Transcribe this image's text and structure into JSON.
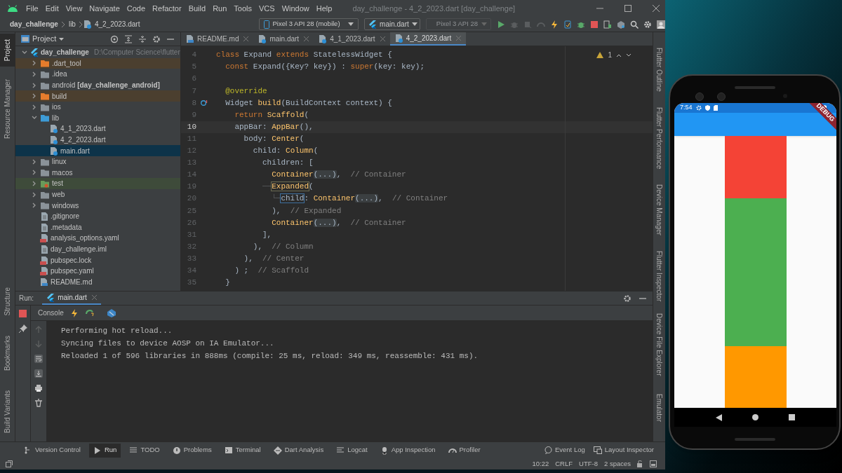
{
  "window": {
    "title": "day_challenge - 4_2_2023.dart [day_challenge]"
  },
  "menu": [
    "File",
    "Edit",
    "View",
    "Navigate",
    "Code",
    "Refactor",
    "Build",
    "Run",
    "Tools",
    "VCS",
    "Window",
    "Help"
  ],
  "breadcrumb": [
    "day_challenge",
    "lib",
    "4_2_2023.dart"
  ],
  "toolbar": {
    "device": "Pixel 3 API 28 (mobile)",
    "config": "main.dart",
    "disabled_device": "Pixel 3 API 28"
  },
  "left_strip_top": [
    {
      "label": "Project",
      "selected": true
    },
    {
      "label": "Resource Manager",
      "selected": false
    }
  ],
  "left_strip_bottom": [
    {
      "label": "Structure",
      "selected": false
    },
    {
      "label": "Bookmarks",
      "selected": false
    },
    {
      "label": "Build Variants",
      "selected": false
    }
  ],
  "right_strip_top": [
    "Flutter Outline",
    "Flutter Performance",
    "Device Manager",
    "Flutter Inspector"
  ],
  "right_strip_bottom": [
    "Device File Explorer",
    "Emulator"
  ],
  "project_panel": {
    "title": "Project",
    "tree": [
      {
        "name": "day_challenge",
        "path": "D:\\Computer Science\\flutter",
        "kind": "root",
        "expanded": true,
        "selected": false,
        "children": [
          {
            "name": ".dart_tool",
            "kind": "excluded_folder",
            "expanded": false,
            "selected": false
          },
          {
            "name": ".idea",
            "kind": "folder",
            "expanded": false,
            "selected": false
          },
          {
            "name": "android **[day_challenge_android]**",
            "kind": "folder",
            "expanded": false,
            "selected": false
          },
          {
            "name": "build",
            "kind": "excluded_folder",
            "expanded": false,
            "selected": false
          },
          {
            "name": "ios",
            "kind": "folder",
            "expanded": false,
            "selected": false
          },
          {
            "name": "lib",
            "kind": "source_folder",
            "expanded": true,
            "selected": false,
            "children": [
              {
                "name": "4_1_2023.dart",
                "kind": "dart",
                "selected": false
              },
              {
                "name": "4_2_2023.dart",
                "kind": "dart",
                "selected": false
              },
              {
                "name": "main.dart",
                "kind": "dart",
                "selected": true
              }
            ]
          },
          {
            "name": "linux",
            "kind": "folder",
            "expanded": false,
            "selected": false
          },
          {
            "name": "macos",
            "kind": "folder",
            "expanded": false,
            "selected": false
          },
          {
            "name": "test",
            "kind": "test_folder",
            "expanded": false,
            "selected": false
          },
          {
            "name": "web",
            "kind": "folder",
            "expanded": false,
            "selected": false
          },
          {
            "name": "windows",
            "kind": "folder",
            "expanded": false,
            "selected": false
          },
          {
            "name": ".gitignore",
            "kind": "file",
            "selected": false
          },
          {
            "name": ".metadata",
            "kind": "file",
            "selected": false
          },
          {
            "name": "analysis_options.yaml",
            "kind": "yaml",
            "selected": false
          },
          {
            "name": "day_challenge.iml",
            "kind": "file",
            "selected": false
          },
          {
            "name": "pubspec.lock",
            "kind": "yaml",
            "selected": false
          },
          {
            "name": "pubspec.yaml",
            "kind": "yaml",
            "selected": false
          },
          {
            "name": "README.md",
            "kind": "md",
            "selected": false
          }
        ]
      }
    ]
  },
  "editor": {
    "tabs": [
      {
        "label": "README.md",
        "kind": "md",
        "selected": false
      },
      {
        "label": "main.dart",
        "kind": "dart",
        "selected": false
      },
      {
        "label": "4_1_2023.dart",
        "kind": "dart",
        "selected": false
      },
      {
        "label": "4_2_2023.dart",
        "kind": "dart",
        "selected": true
      }
    ],
    "warnings": "1",
    "lines": [
      {
        "n": "4",
        "current": false,
        "kind": "code",
        "tokens": [
          {
            "kind": "keyword",
            "text": "class "
          },
          {
            "kind": "plain",
            "text": "Expand "
          },
          {
            "kind": "keyword",
            "text": "extends "
          },
          {
            "kind": "plain",
            "text": "StatelessWidget {"
          }
        ]
      },
      {
        "n": "5",
        "current": false,
        "kind": "code",
        "tokens": [
          {
            "kind": "keyword",
            "text": "  const "
          },
          {
            "kind": "plain",
            "text": "Expand({Key? key}) : "
          },
          {
            "kind": "keyword",
            "text": "super"
          },
          {
            "kind": "plain",
            "text": "(key: key);"
          }
        ]
      },
      {
        "n": "6",
        "current": false,
        "kind": "code"
      },
      {
        "n": "7",
        "current": false,
        "kind": "code",
        "tokens": [
          {
            "kind": "annotation",
            "text": "  @override"
          }
        ]
      },
      {
        "n": "8",
        "current": false,
        "kind": "override",
        "tokens": [
          {
            "kind": "plain",
            "text": "  Widget "
          },
          {
            "kind": "function",
            "text": "build"
          },
          {
            "kind": "plain",
            "text": "(BuildContext context) {"
          }
        ]
      },
      {
        "n": "9",
        "current": false,
        "kind": "code",
        "tokens": [
          {
            "kind": "keyword",
            "text": "    return "
          },
          {
            "kind": "function",
            "text": "Scaffold"
          },
          {
            "kind": "plain",
            "text": "("
          }
        ]
      },
      {
        "n": "10",
        "current": true,
        "kind": "code",
        "tokens": [
          {
            "kind": "plain",
            "text": "    appBar: "
          },
          {
            "kind": "function",
            "text": "AppBar"
          },
          {
            "kind": "plain",
            "text": "(),"
          }
        ]
      },
      {
        "n": "11",
        "current": false,
        "kind": "code",
        "tokens": [
          {
            "kind": "plain",
            "text": "      body: "
          },
          {
            "kind": "function",
            "text": "Center"
          },
          {
            "kind": "plain",
            "text": "("
          }
        ]
      },
      {
        "n": "12",
        "current": false,
        "kind": "code",
        "tokens": [
          {
            "kind": "plain",
            "text": "        child: "
          },
          {
            "kind": "function",
            "text": "Column"
          },
          {
            "kind": "plain",
            "text": "("
          }
        ]
      },
      {
        "n": "13",
        "current": false,
        "kind": "code",
        "tokens": [
          {
            "kind": "plain",
            "text": "          children: ["
          }
        ]
      },
      {
        "n": "14",
        "current": false,
        "kind": "code",
        "tokens": [
          {
            "kind": "function",
            "text": "            Container"
          },
          {
            "kind": "folded",
            "text": "(...)"
          },
          {
            "kind": "plain",
            "text": ",  "
          },
          {
            "kind": "comment",
            "text": "// Container"
          }
        ]
      },
      {
        "n": "19",
        "current": false,
        "kind": "code",
        "tokens": [
          {
            "kind": "guide",
            "text": "          ──"
          },
          {
            "kind": "matched",
            "text": "Expanded"
          },
          {
            "kind": "plain",
            "text": "("
          }
        ]
      },
      {
        "n": "20",
        "current": false,
        "kind": "code",
        "tokens": [
          {
            "kind": "guide",
            "text": "            └─"
          },
          {
            "kind": "boxed",
            "text": "child"
          },
          {
            "kind": "plain",
            "text": ": "
          },
          {
            "kind": "function",
            "text": "Container"
          },
          {
            "kind": "folded",
            "text": "(...)"
          },
          {
            "kind": "plain",
            "text": ",  "
          },
          {
            "kind": "comment",
            "text": "// Container"
          }
        ]
      },
      {
        "n": "25",
        "current": false,
        "kind": "code",
        "tokens": [
          {
            "kind": "plain",
            "text": "            ),  "
          },
          {
            "kind": "comment",
            "text": "// Expanded"
          }
        ]
      },
      {
        "n": "26",
        "current": false,
        "kind": "code",
        "tokens": [
          {
            "kind": "function",
            "text": "            Container"
          },
          {
            "kind": "folded",
            "text": "(...)"
          },
          {
            "kind": "plain",
            "text": ",  "
          },
          {
            "kind": "comment",
            "text": "// Container"
          }
        ]
      },
      {
        "n": "31",
        "current": false,
        "kind": "code",
        "tokens": [
          {
            "kind": "plain",
            "text": "          ],"
          }
        ]
      },
      {
        "n": "32",
        "current": false,
        "kind": "code",
        "tokens": [
          {
            "kind": "plain",
            "text": "        ),  "
          },
          {
            "kind": "comment",
            "text": "// Column"
          }
        ]
      },
      {
        "n": "33",
        "current": false,
        "kind": "code",
        "tokens": [
          {
            "kind": "plain",
            "text": "      ),  "
          },
          {
            "kind": "comment",
            "text": "// Center"
          }
        ]
      },
      {
        "n": "34",
        "current": false,
        "kind": "code",
        "tokens": [
          {
            "kind": "plain",
            "text": "    ) ;  "
          },
          {
            "kind": "comment",
            "text": "// Scaffold"
          }
        ]
      },
      {
        "n": "35",
        "current": false,
        "kind": "code",
        "tokens": [
          {
            "kind": "plain",
            "text": "  }"
          }
        ]
      }
    ]
  },
  "run_panel": {
    "label": "Run:",
    "tab": "main.dart",
    "console_tab": "Console",
    "output": [
      "Performing hot reload...",
      "Syncing files to device AOSP on IA Emulator...",
      "Reloaded 1 of 596 libraries in 888ms (compile: 25 ms, reload: 349 ms, reassemble: 431 ms)."
    ]
  },
  "tool_windows": [
    {
      "label": "Version Control",
      "selected": false
    },
    {
      "label": "Run",
      "selected": true
    },
    {
      "label": "TODO",
      "selected": false
    },
    {
      "label": "Problems",
      "selected": false
    },
    {
      "label": "Terminal",
      "selected": false
    },
    {
      "label": "Dart Analysis",
      "selected": false
    },
    {
      "label": "Logcat",
      "selected": false
    },
    {
      "label": "App Inspection",
      "selected": false
    },
    {
      "label": "Profiler",
      "selected": false
    }
  ],
  "right_tools": [
    "Event Log",
    "Layout Inspector"
  ],
  "status_bar": [
    "10:22",
    "CRLF",
    "UTF-8",
    "2 spaces"
  ],
  "phone": {
    "status_time": "7:54",
    "debug_banner": "DEBUG",
    "blocks": [
      {
        "kind": "fixed",
        "color": "#f44336"
      },
      {
        "kind": "expanded",
        "color": "#4caf50"
      },
      {
        "kind": "fixed",
        "color": "#ff9800"
      }
    ]
  }
}
